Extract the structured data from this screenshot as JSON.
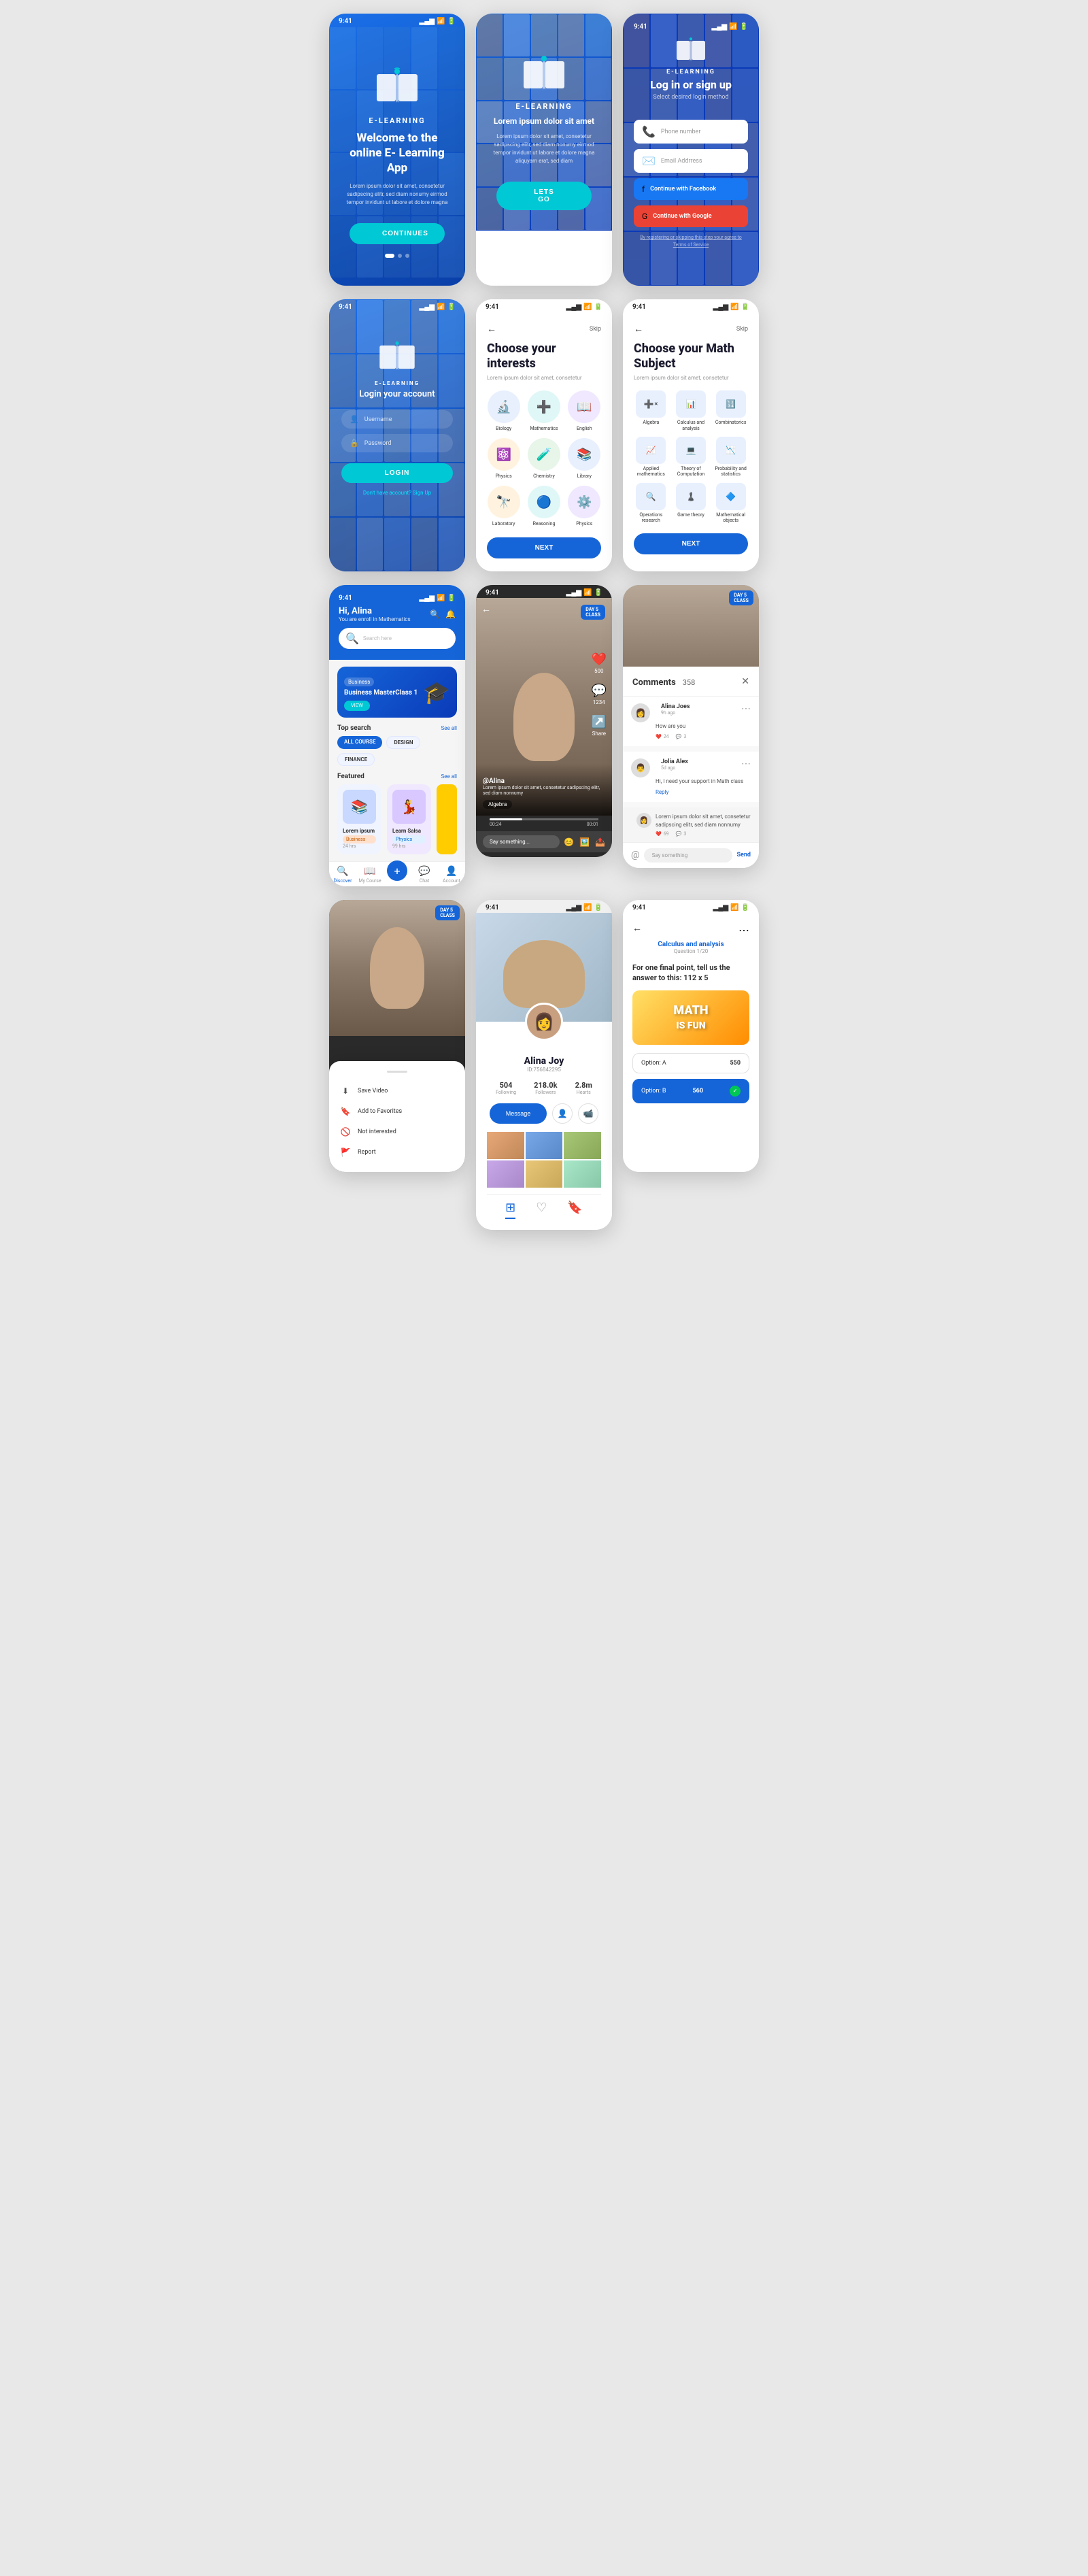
{
  "app": {
    "name": "E-LEARNING",
    "tagline": "Welcome to the online E- Learning App",
    "desc": "Lorem ipsum dolor sit amet, consetetur sadipscing elitr, sed diam nonumy eirmod tempor invidunt ut labore et dolore magna",
    "btn_continue": "CONTINUES",
    "btn_letsgo": "LETS GO",
    "lorem_sub": "Lorem ipsum dolor sit amet",
    "lorem_sub2": "Lorem ipsum dolor sit amet, consetetur sadipscing elitr, sed diam nonumy eirmod tempor invidunt ut labore et dolore magna aliquyam erat, sed diam"
  },
  "login": {
    "title": "Login your account",
    "username_placeholder": "Username",
    "password_placeholder": "Password",
    "btn": "LOGIN",
    "signup_text": "Don't have account?",
    "signup_link": "Sign Up"
  },
  "auth": {
    "title": "Log in or sign up",
    "sub": "Select desired login method",
    "phone_placeholder": "Phone number",
    "email_placeholder": "Email Addrress",
    "btn_facebook": "Continue with Facebook",
    "btn_google": "Continue with Google",
    "terms": "By registering or skipping this step your agree to",
    "terms_link": "Terms of Service"
  },
  "interests": {
    "title": "Choose your interests",
    "sub": "Lorem ipsum dolor sit amet, consetetur",
    "skip": "Skip",
    "items": [
      {
        "label": "Biology",
        "icon": "🔬",
        "color": "ic-blue"
      },
      {
        "label": "Mathematics",
        "icon": "➕",
        "color": "ic-teal"
      },
      {
        "label": "English",
        "icon": "📖",
        "color": "ic-purple"
      },
      {
        "label": "Physics",
        "icon": "⚛️",
        "color": "ic-orange"
      },
      {
        "label": "Chemistry",
        "icon": "🧪",
        "color": "ic-green"
      },
      {
        "label": "Library",
        "icon": "📚",
        "color": "ic-blue"
      },
      {
        "label": "Laboratory",
        "icon": "🔭",
        "color": "ic-orange"
      },
      {
        "label": "Reasoning",
        "icon": "🔵",
        "color": "ic-teal"
      },
      {
        "label": "Physics",
        "icon": "⚙️",
        "color": "ic-purple"
      }
    ],
    "btn_next": "NEXT"
  },
  "math_subjects": {
    "title": "Choose your Math Subject",
    "sub": "Lorem ipsum dolor sit amet, consetetur",
    "skip": "Skip",
    "items": [
      {
        "label": "Algebra",
        "icon": "📐"
      },
      {
        "label": "Calculus and analysis",
        "icon": "📊"
      },
      {
        "label": "Combinatorics",
        "icon": "🔢"
      },
      {
        "label": "Applied mathematics",
        "icon": "📈"
      },
      {
        "label": "Theory of Computation",
        "icon": "💻"
      },
      {
        "label": "Probability and statistics",
        "icon": "📉"
      },
      {
        "label": "Operations research",
        "icon": "🔍"
      },
      {
        "label": "Game theory",
        "icon": "♟️"
      },
      {
        "label": "Mathematical objects",
        "icon": "🔷"
      }
    ],
    "btn_next": "NEXT"
  },
  "dashboard": {
    "greeting": "Hi, Alina",
    "enrolled": "You are enroll in Mathematics",
    "search_placeholder": "Search here",
    "featured_card": {
      "badge": "Business",
      "title": "Business MasterClass 1",
      "btn": "VIEW"
    },
    "top_search": "Top search",
    "see_all": "See all",
    "tags": [
      "ALL COURSE",
      "DESIGN",
      "FINANCE"
    ],
    "featured": "Featured",
    "courses": [
      {
        "title": "Lorem ipsum",
        "badge": "Business",
        "hours": "24 hrs"
      },
      {
        "title": "Learn Salsa",
        "badge": "Physics",
        "hours": "99 hrs"
      }
    ]
  },
  "nav": {
    "items": [
      "Discover",
      "My Course",
      "+",
      "Chat",
      "Account"
    ]
  },
  "video": {
    "time_current": "00:24",
    "time_total": "00:01",
    "user": "@Alina",
    "desc": "Lorem ipsum dolor sit amet, consetetur sadipscing elitr, sed diam nonnumy",
    "subject": "Algebra",
    "say_placeholder": "Say something...",
    "likes": "500",
    "comments": "1234",
    "day_badge": "DAY 5\nCLASS"
  },
  "comments": {
    "title": "Comments",
    "count": "358",
    "items": [
      {
        "user": "Alina Joes",
        "time": "9h ago",
        "text": "How are you",
        "likes": "24",
        "replies": "3"
      },
      {
        "user": "Jolia Alex",
        "time": "5d ago",
        "text": "Hi, I need your support in Math class",
        "reply_text": "Lorem ipsum dolor sit amet, consetetur sadipscing elitr, sed diam nonnumy",
        "likes": "69",
        "replies": "3",
        "reply_label": "Reply"
      }
    ],
    "say_placeholder": "Say something",
    "send_btn": "Send"
  },
  "options_sheet": {
    "items": [
      {
        "icon": "⬇",
        "label": "Save Video"
      },
      {
        "icon": "🔖",
        "label": "Add to Favorites"
      },
      {
        "icon": "🚫",
        "label": "Not interested"
      },
      {
        "icon": "🚩",
        "label": "Report"
      }
    ]
  },
  "profile": {
    "name": "Alina Joy",
    "id": "ID:756842295",
    "stats": [
      {
        "value": "504",
        "label": "Following"
      },
      {
        "value": "218.0k",
        "label": "Followers"
      },
      {
        "value": "2.8m",
        "label": "Hearts"
      }
    ],
    "btn_message": "Message"
  },
  "quiz": {
    "subject": "Calculus and analysis",
    "question_num": "Question 1/20",
    "question": "For one final point, tell us the answer to this: 112 x 5",
    "options": [
      {
        "label": "Option: A",
        "value": "550",
        "selected": false
      },
      {
        "label": "Option: B",
        "value": "560",
        "selected": true
      }
    ]
  },
  "status_bar": {
    "time": "9:41",
    "signal": "▂▄▆",
    "wifi": "WiFi",
    "battery": "■"
  }
}
